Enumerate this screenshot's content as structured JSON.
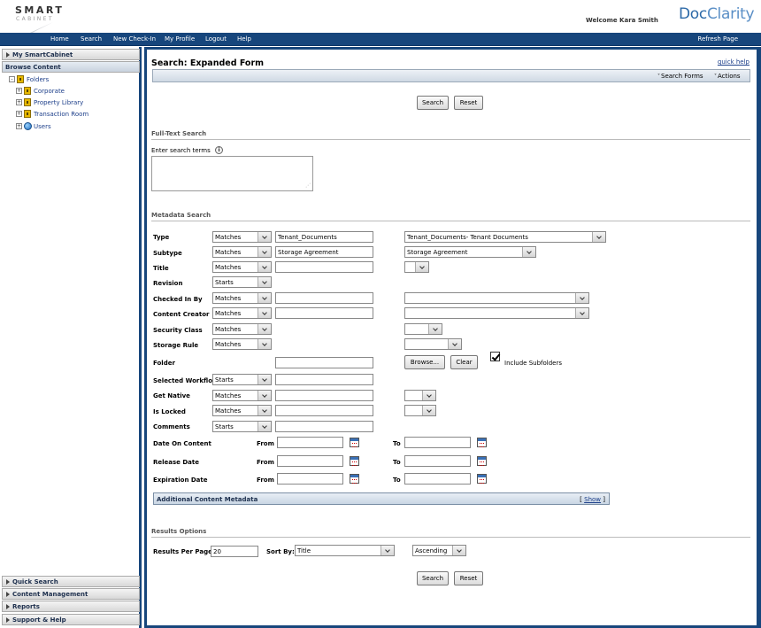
{
  "header": {
    "logo_line1": "SMART",
    "logo_line2": "CABINET",
    "welcome": "Welcome Kara Smith",
    "brand_part1": "Doc",
    "brand_part2": "Clarity"
  },
  "nav": {
    "items": [
      "Home",
      "Search",
      "New Check-In",
      "My Profile",
      "Logout",
      "Help"
    ],
    "refresh": "Refresh Page"
  },
  "sidebar": {
    "my_smartcabinet": "My SmartCabinet",
    "browse_content": "Browse Content",
    "folders": "Folders",
    "tree": [
      "Corporate",
      "Property Library",
      "Transaction Room",
      "Users"
    ],
    "bottom": [
      "Quick Search",
      "Content Management",
      "Reports",
      "Support & Help"
    ]
  },
  "main": {
    "title": "Search: Expanded Form",
    "quick_help": "quick help",
    "search_forms": "Search Forms",
    "actions": "Actions",
    "search_btn": "Search",
    "reset_btn": "Reset",
    "fulltext_title": "Full-Text Search",
    "enter_terms": "Enter search terms",
    "info_icon_glyph": "i",
    "metadata_title": "Metadata Search",
    "rows": {
      "type": {
        "label": "Type",
        "op": "Matches",
        "value": "Tenant_Documents",
        "pick": "Tenant_Documents- Tenant Documents"
      },
      "subtype": {
        "label": "Subtype",
        "op": "Matches",
        "value": "Storage Agreement",
        "pick": "Storage Agreement"
      },
      "title": {
        "label": "Title",
        "op": "Matches"
      },
      "revision": {
        "label": "Revision",
        "op": "Starts"
      },
      "checked_in_by": {
        "label": "Checked In By",
        "op": "Matches"
      },
      "content_creator": {
        "label": "Content Creator",
        "op": "Matches"
      },
      "security_class": {
        "label": "Security Class",
        "op": "Matches"
      },
      "storage_rule": {
        "label": "Storage Rule",
        "op": "Matches"
      },
      "folder": {
        "label": "Folder",
        "browse": "Browse...",
        "clear": "Clear",
        "include": "Include Subfolders"
      },
      "selected_workflow": {
        "label": "Selected Workflow",
        "op": "Starts"
      },
      "get_native": {
        "label": "Get Native",
        "op": "Matches"
      },
      "is_locked": {
        "label": "Is Locked",
        "op": "Matches"
      },
      "comments": {
        "label": "Comments",
        "op": "Starts"
      }
    },
    "dates": [
      {
        "label": "Date On Content",
        "from": "From",
        "to": "To"
      },
      {
        "label": "Release Date",
        "from": "From",
        "to": "To"
      },
      {
        "label": "Expiration Date",
        "from": "From",
        "to": "To"
      }
    ],
    "additional_metadata": "Additional Content Metadata",
    "show": "Show",
    "results_title": "Results Options",
    "results_per_page_label": "Results Per Page:",
    "results_per_page": "20",
    "sort_by_label": "Sort By:",
    "sort_by": "Title",
    "sort_order": "Ascending"
  }
}
